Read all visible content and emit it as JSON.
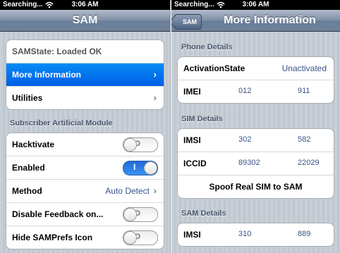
{
  "left": {
    "status": {
      "carrier": "Searching...",
      "time": "3:06 AM"
    },
    "nav_title": "SAM",
    "group1": [
      {
        "label": "SAMState: Loaded OK"
      },
      {
        "label": "More Information"
      },
      {
        "label": "Utilities"
      }
    ],
    "section_title": "Subscriber Artificial Module",
    "group2": [
      {
        "label": "Hacktivate",
        "switch_glyph": "O"
      },
      {
        "label": "Enabled",
        "switch_glyph": "I"
      },
      {
        "label": "Method",
        "value": "Auto Detect"
      },
      {
        "label": "Disable Feedback on...",
        "switch_glyph": "O"
      },
      {
        "label": "Hide SAMPrefs Icon",
        "switch_glyph": "O"
      }
    ]
  },
  "right": {
    "status": {
      "carrier": "Searching...",
      "time": "3:06 AM"
    },
    "back_label": "SAM",
    "nav_title": "More Information",
    "phone_section": "Phone Details",
    "phone": [
      {
        "label": "ActivationState",
        "value": "Unactivated"
      },
      {
        "label": "IMEI",
        "c1": "012",
        "c2": "911"
      }
    ],
    "sim_section": "SIM Details",
    "sim": [
      {
        "label": "IMSI",
        "c1": "302",
        "c2": "582"
      },
      {
        "label": "ICCID",
        "c1": "89302",
        "c2": "22029"
      },
      {
        "label": "Spoof Real SIM to SAM"
      }
    ],
    "sam_section": "SAM Details",
    "sam": [
      {
        "label": "IMSI",
        "c1": "310",
        "c2": "889"
      }
    ]
  }
}
